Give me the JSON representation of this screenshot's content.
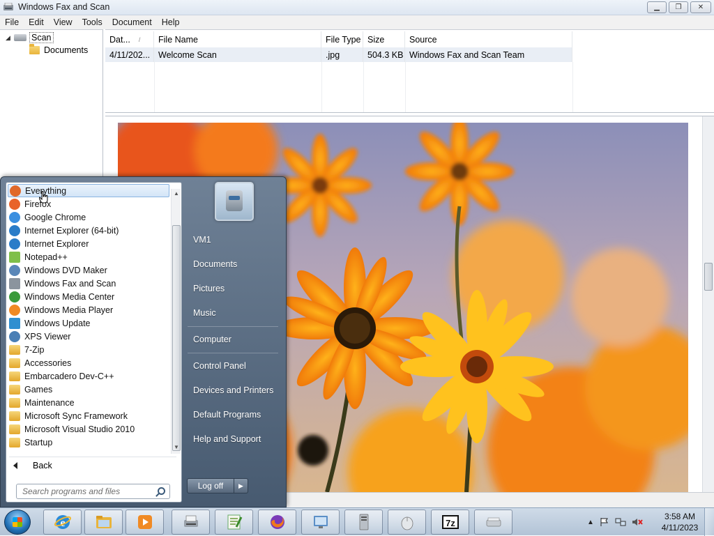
{
  "window": {
    "title": "Windows Fax and Scan",
    "menu": [
      "File",
      "Edit",
      "View",
      "Tools",
      "Document",
      "Help"
    ]
  },
  "tree": {
    "root": "Scan",
    "child": "Documents"
  },
  "list": {
    "columns": [
      "Dat...",
      "File Name",
      "File Type",
      "Size",
      "Source"
    ],
    "rows": [
      {
        "date": "4/11/202...",
        "name": "Welcome Scan",
        "type": ".jpg",
        "size": "504.3 KB",
        "source": "Windows Fax and Scan Team"
      }
    ]
  },
  "start_menu": {
    "programs": [
      {
        "label": "Everything",
        "icon": "everything-icon",
        "color": "#e0692a"
      },
      {
        "label": "Firefox",
        "icon": "firefox-icon",
        "color": "#e8632a"
      },
      {
        "label": "Google Chrome",
        "icon": "chrome-icon",
        "color": "#3a8fe0"
      },
      {
        "label": "Internet Explorer (64-bit)",
        "icon": "ie-icon",
        "color": "#2a7cc8"
      },
      {
        "label": "Internet Explorer",
        "icon": "ie-icon",
        "color": "#2a7cc8"
      },
      {
        "label": "Notepad++",
        "icon": "notepadpp-icon",
        "color": "#7fbf4a"
      },
      {
        "label": "Windows DVD Maker",
        "icon": "dvd-maker-icon",
        "color": "#5a87b8"
      },
      {
        "label": "Windows Fax and Scan",
        "icon": "fax-scan-icon",
        "color": "#8b949e"
      },
      {
        "label": "Windows Media Center",
        "icon": "media-center-icon",
        "color": "#3a9a3a"
      },
      {
        "label": "Windows Media Player",
        "icon": "media-player-icon",
        "color": "#f08a24"
      },
      {
        "label": "Windows Update",
        "icon": "windows-update-icon",
        "color": "#2f8fd0"
      },
      {
        "label": "XPS Viewer",
        "icon": "xps-viewer-icon",
        "color": "#4a7fb5"
      },
      {
        "label": "7-Zip",
        "icon": "folder-icon",
        "color": "#e9b43b"
      },
      {
        "label": "Accessories",
        "icon": "folder-icon",
        "color": "#e9b43b"
      },
      {
        "label": "Embarcadero Dev-C++",
        "icon": "folder-icon",
        "color": "#e9b43b"
      },
      {
        "label": "Games",
        "icon": "folder-icon",
        "color": "#e9b43b"
      },
      {
        "label": "Maintenance",
        "icon": "folder-icon",
        "color": "#e9b43b"
      },
      {
        "label": "Microsoft Sync Framework",
        "icon": "folder-icon",
        "color": "#e9b43b"
      },
      {
        "label": "Microsoft Visual Studio 2010",
        "icon": "folder-icon",
        "color": "#e9b43b"
      },
      {
        "label": "Startup",
        "icon": "folder-icon",
        "color": "#e9b43b"
      }
    ],
    "back_label": "Back",
    "search_placeholder": "Search programs and files",
    "right_items": [
      "VM1",
      "Documents",
      "Pictures",
      "Music",
      "Computer",
      "Control Panel",
      "Devices and Printers",
      "Default Programs",
      "Help and Support"
    ],
    "logoff_label": "Log off"
  },
  "taskbar": {
    "pinned": [
      "internet-explorer",
      "windows-explorer",
      "windows-media-player",
      "windows-fax-and-scan",
      "notepad-plus-plus",
      "firefox",
      "control-panel",
      "computer-manager",
      "mouse-settings",
      "7-zip",
      "scanner"
    ],
    "clock_time": "3:58 AM",
    "clock_date": "4/11/2023"
  },
  "colors": {
    "start_menu_bg": "#5b6d82",
    "taskbar_bg": "#bfcfe0",
    "highlight": "#d3e5f7"
  }
}
